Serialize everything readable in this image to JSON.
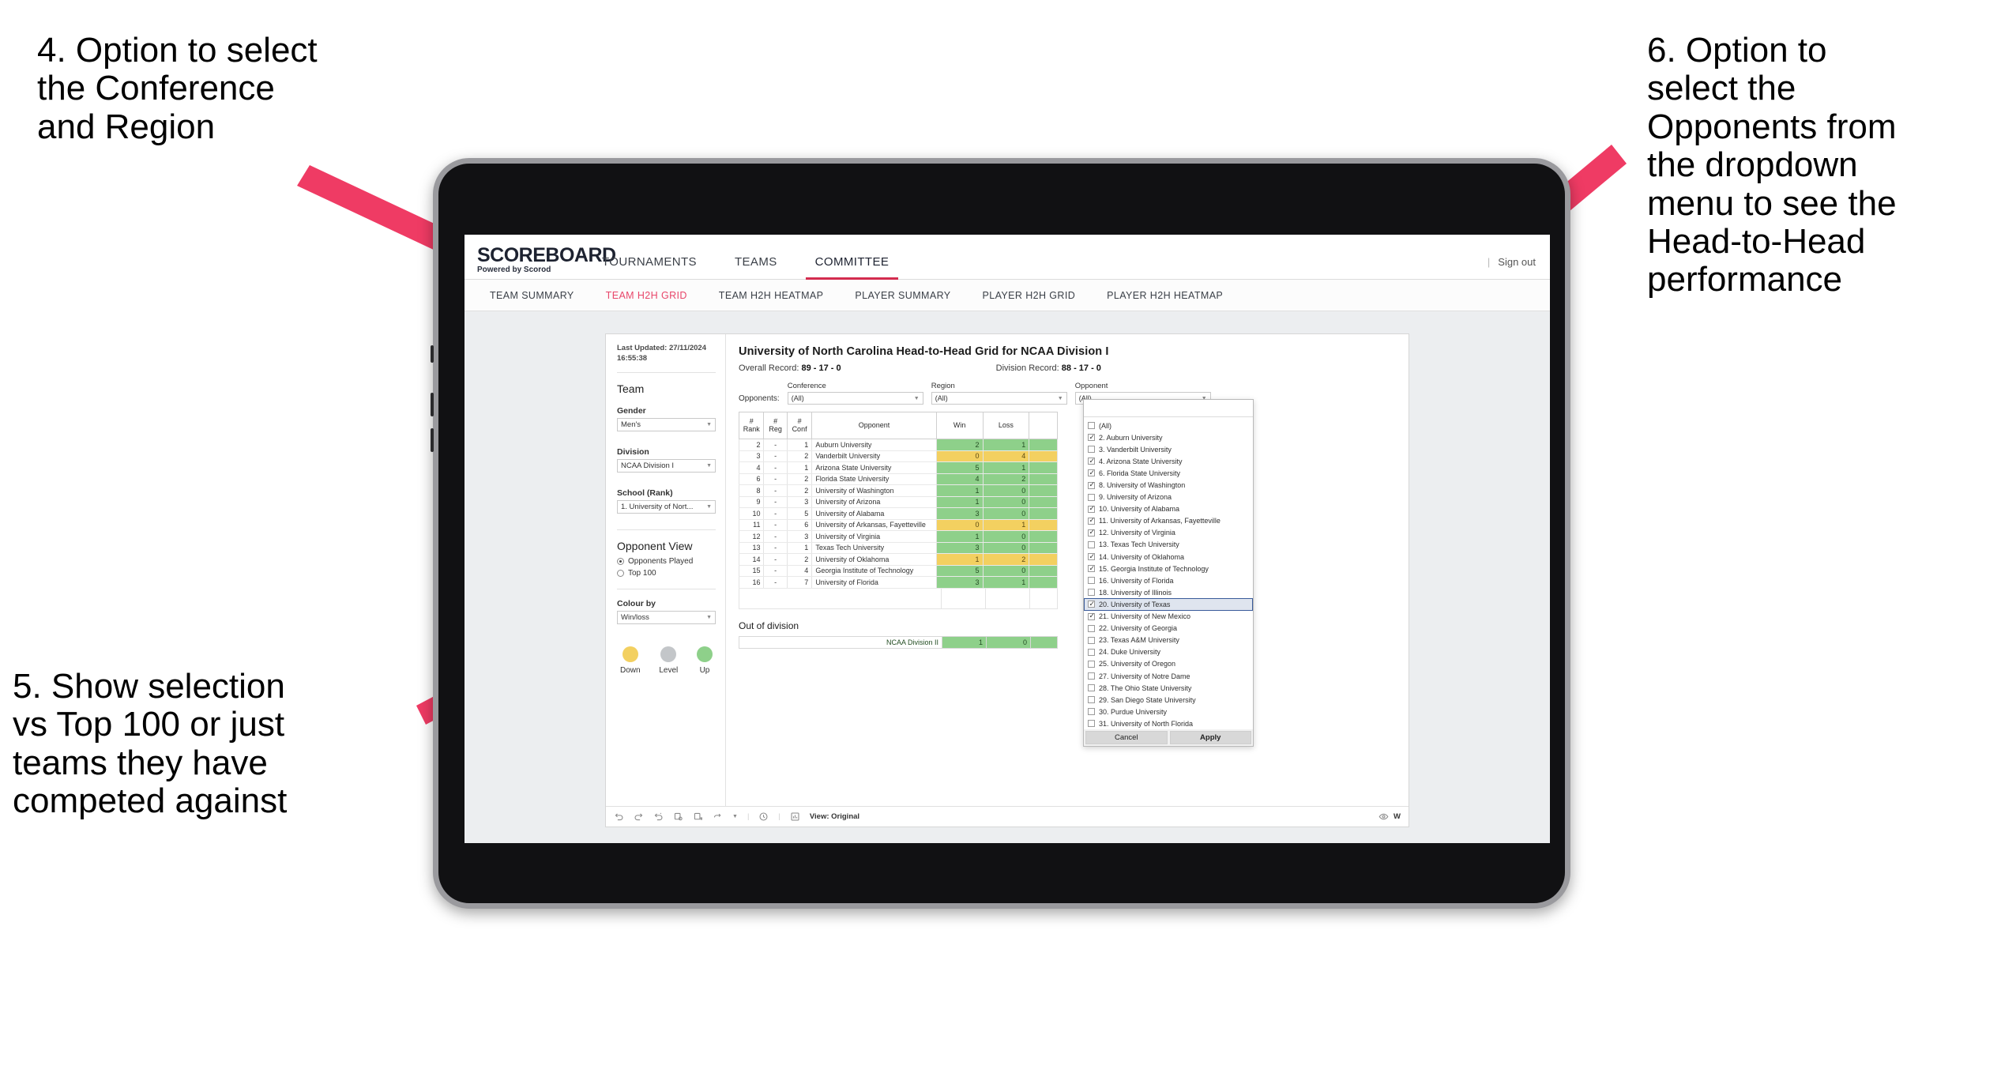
{
  "annotations": [
    {
      "id": "callout-4",
      "text": "4. Option to select\nthe Conference\nand Region"
    },
    {
      "id": "callout-5",
      "text": "5. Show selection\nvs Top 100 or just\nteams they have\ncompeted against"
    },
    {
      "id": "callout-6",
      "text": "6. Option to\nselect the\nOpponents from\nthe dropdown\nmenu to see the\nHead-to-Head\nperformance"
    }
  ],
  "accent_color": "#e8466a",
  "header": {
    "logo_title": "SCOREBOARD",
    "logo_sub": "Powered by Scorod",
    "nav": [
      {
        "label": "TOURNAMENTS",
        "active": false
      },
      {
        "label": "TEAMS",
        "active": false
      },
      {
        "label": "COMMITTEE",
        "active": true
      }
    ],
    "separator": "|",
    "sign_out": "Sign out"
  },
  "subnav": [
    {
      "label": "TEAM SUMMARY",
      "active": false
    },
    {
      "label": "TEAM H2H GRID",
      "active": true
    },
    {
      "label": "TEAM H2H HEATMAP",
      "active": false
    },
    {
      "label": "PLAYER SUMMARY",
      "active": false
    },
    {
      "label": "PLAYER H2H GRID",
      "active": false
    },
    {
      "label": "PLAYER H2H HEATMAP",
      "active": false
    }
  ],
  "controls": {
    "last_updated_line1": "Last Updated: 27/11/2024",
    "last_updated_line2": "16:55:38",
    "team_heading": "Team",
    "gender_label": "Gender",
    "gender_value": "Men's",
    "division_label": "Division",
    "division_value": "NCAA Division I",
    "school_label": "School (Rank)",
    "school_value": "1. University of Nort...",
    "opponent_view_heading": "Opponent View",
    "radio_played": "Opponents Played",
    "radio_top100": "Top 100",
    "radio_selected": "Opponents Played",
    "colour_by_label": "Colour by",
    "colour_by_value": "Win/loss",
    "legend": [
      {
        "caption": "Down",
        "color": "#f3d060"
      },
      {
        "caption": "Level",
        "color": "#c3c6c9"
      },
      {
        "caption": "Up",
        "color": "#8ed08a"
      }
    ]
  },
  "viz": {
    "title": "University of North Carolina Head-to-Head Grid for NCAA Division I",
    "overall_record_label": "Overall Record:",
    "overall_record_value": "89 - 17 - 0",
    "division_record_label": "Division Record:",
    "division_record_value": "88 - 17 - 0",
    "opponents_lead": "Opponents:",
    "filters": [
      {
        "label": "Conference",
        "value": "(All)"
      },
      {
        "label": "Region",
        "value": "(All)"
      },
      {
        "label": "Opponent",
        "value": "(All)"
      }
    ],
    "out_of_division_title": "Out of division",
    "out_of_division_row": {
      "name": "NCAA Division II",
      "win": "1",
      "loss": "0"
    }
  },
  "chart_data": {
    "type": "table",
    "title": "University of North Carolina Head-to-Head Grid for NCAA Division I",
    "columns": [
      "# Rank",
      "# Reg",
      "# Conf",
      "Opponent",
      "Win",
      "Loss"
    ],
    "column_header_lines": [
      [
        "#",
        "Rank"
      ],
      [
        "#",
        "Reg"
      ],
      [
        "#",
        "Conf"
      ],
      [
        "Opponent"
      ],
      [
        "Win"
      ],
      [
        "Loss"
      ]
    ],
    "colour_semantics": {
      "up": "#8ed08a",
      "down": "#f3d060",
      "level": "#c3c6c9"
    },
    "rows": [
      {
        "rank": "2",
        "reg": "-",
        "conf": "1",
        "opponent": "Auburn University",
        "win": "2",
        "loss": "1",
        "state": "up"
      },
      {
        "rank": "3",
        "reg": "-",
        "conf": "2",
        "opponent": "Vanderbilt University",
        "win": "0",
        "loss": "4",
        "state": "down"
      },
      {
        "rank": "4",
        "reg": "-",
        "conf": "1",
        "opponent": "Arizona State University",
        "win": "5",
        "loss": "1",
        "state": "up"
      },
      {
        "rank": "6",
        "reg": "-",
        "conf": "2",
        "opponent": "Florida State University",
        "win": "4",
        "loss": "2",
        "state": "up"
      },
      {
        "rank": "8",
        "reg": "-",
        "conf": "2",
        "opponent": "University of Washington",
        "win": "1",
        "loss": "0",
        "state": "up"
      },
      {
        "rank": "9",
        "reg": "-",
        "conf": "3",
        "opponent": "University of Arizona",
        "win": "1",
        "loss": "0",
        "state": "up"
      },
      {
        "rank": "10",
        "reg": "-",
        "conf": "5",
        "opponent": "University of Alabama",
        "win": "3",
        "loss": "0",
        "state": "up"
      },
      {
        "rank": "11",
        "reg": "-",
        "conf": "6",
        "opponent": "University of Arkansas, Fayetteville",
        "win": "0",
        "loss": "1",
        "state": "down"
      },
      {
        "rank": "12",
        "reg": "-",
        "conf": "3",
        "opponent": "University of Virginia",
        "win": "1",
        "loss": "0",
        "state": "up"
      },
      {
        "rank": "13",
        "reg": "-",
        "conf": "1",
        "opponent": "Texas Tech University",
        "win": "3",
        "loss": "0",
        "state": "up"
      },
      {
        "rank": "14",
        "reg": "-",
        "conf": "2",
        "opponent": "University of Oklahoma",
        "win": "1",
        "loss": "2",
        "state": "down"
      },
      {
        "rank": "15",
        "reg": "-",
        "conf": "4",
        "opponent": "Georgia Institute of Technology",
        "win": "5",
        "loss": "0",
        "state": "up"
      },
      {
        "rank": "16",
        "reg": "-",
        "conf": "7",
        "opponent": "University of Florida",
        "win": "3",
        "loss": "1",
        "state": "up"
      }
    ]
  },
  "dropdown": {
    "cancel_label": "Cancel",
    "apply_label": "Apply",
    "items": [
      {
        "label": "(All)",
        "checked": false,
        "selected": false
      },
      {
        "label": "2. Auburn University",
        "checked": true,
        "selected": false
      },
      {
        "label": "3. Vanderbilt University",
        "checked": false,
        "selected": false
      },
      {
        "label": "4. Arizona State University",
        "checked": true,
        "selected": false
      },
      {
        "label": "6. Florida State University",
        "checked": true,
        "selected": false
      },
      {
        "label": "8. University of Washington",
        "checked": true,
        "selected": false
      },
      {
        "label": "9. University of Arizona",
        "checked": false,
        "selected": false
      },
      {
        "label": "10. University of Alabama",
        "checked": true,
        "selected": false
      },
      {
        "label": "11. University of Arkansas, Fayetteville",
        "checked": true,
        "selected": false
      },
      {
        "label": "12. University of Virginia",
        "checked": true,
        "selected": false
      },
      {
        "label": "13. Texas Tech University",
        "checked": false,
        "selected": false
      },
      {
        "label": "14. University of Oklahoma",
        "checked": true,
        "selected": false
      },
      {
        "label": "15. Georgia Institute of Technology",
        "checked": true,
        "selected": false
      },
      {
        "label": "16. University of Florida",
        "checked": false,
        "selected": false
      },
      {
        "label": "18. University of Illinois",
        "checked": false,
        "selected": false
      },
      {
        "label": "20. University of Texas",
        "checked": true,
        "selected": true
      },
      {
        "label": "21. University of New Mexico",
        "checked": true,
        "selected": false
      },
      {
        "label": "22. University of Georgia",
        "checked": false,
        "selected": false
      },
      {
        "label": "23. Texas A&M University",
        "checked": false,
        "selected": false
      },
      {
        "label": "24. Duke University",
        "checked": false,
        "selected": false
      },
      {
        "label": "25. University of Oregon",
        "checked": false,
        "selected": false
      },
      {
        "label": "27. University of Notre Dame",
        "checked": false,
        "selected": false
      },
      {
        "label": "28. The Ohio State University",
        "checked": false,
        "selected": false
      },
      {
        "label": "29. San Diego State University",
        "checked": false,
        "selected": false
      },
      {
        "label": "30. Purdue University",
        "checked": false,
        "selected": false
      },
      {
        "label": "31. University of North Florida",
        "checked": false,
        "selected": false
      }
    ]
  },
  "toolbar": {
    "view_label": "View: Original",
    "watch_label": "W",
    "separator": "|"
  }
}
